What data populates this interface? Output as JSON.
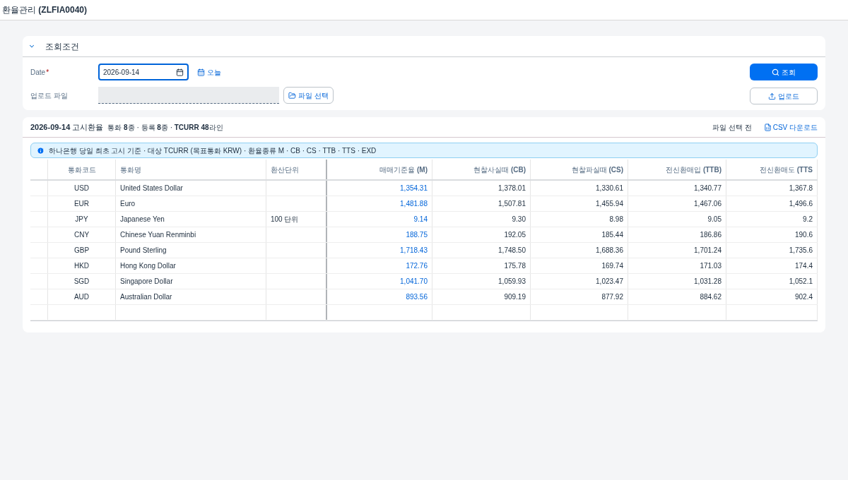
{
  "page_title": "환율관리 **(ZLFIA0040)**",
  "filter_panel": {
    "title": "조회조건",
    "expanded": true,
    "date_label": "Date",
    "required_mark": "*",
    "date_value": "2026-09-14",
    "today_link": "오늘",
    "upload_label": "업로드 파일",
    "file_button": "파일 선택",
    "search_button": "조회",
    "upload_button": "업로드"
  },
  "result_panel": {
    "date": "2026-09-14",
    "title": "고시환율",
    "summary": "통화 **8**종 · 등록 **8**종 · **TCURR 48**라인",
    "file_status": "파일 선택 전",
    "csv_link": "CSV 다운로드",
    "info": "하나은행 당일 최초 고시 기준 · 대상 TCURR (목표통화 KRW) · 환율종류 M · CB · CS · TTB · TTS · EXD",
    "table": {
      "columns": [
        "통화코드",
        "통화명",
        "환산단위",
        "매매기준율 **(M)**",
        "현찰사실때 **(CB)**",
        "현찰파실때 **(CS)**",
        "전신환매입 **(TTB)**",
        "전신환매도 **(TTS**"
      ],
      "rows": [
        [
          "USD",
          "United States Dollar",
          "",
          "1,354.31",
          "1,378.01",
          "1,330.61",
          "1,340.77",
          "1,367.8"
        ],
        [
          "EUR",
          "Euro",
          "",
          "1,481.88",
          "1,507.81",
          "1,455.94",
          "1,467.06",
          "1,496.6"
        ],
        [
          "JPY",
          "Japanese Yen",
          "100 단위",
          "9.14",
          "9.30",
          "8.98",
          "9.05",
          "9.2"
        ],
        [
          "CNY",
          "Chinese Yuan Renminbi",
          "",
          "188.75",
          "192.05",
          "185.44",
          "186.86",
          "190.6"
        ],
        [
          "GBP",
          "Pound Sterling",
          "",
          "1,718.43",
          "1,748.50",
          "1,688.36",
          "1,701.24",
          "1,735.6"
        ],
        [
          "HKD",
          "Hong Kong Dollar",
          "",
          "172.76",
          "175.78",
          "169.74",
          "171.03",
          "174.4"
        ],
        [
          "SGD",
          "Singapore Dollar",
          "",
          "1,041.70",
          "1,059.93",
          "1,023.47",
          "1,031.28",
          "1,052.1"
        ],
        [
          "AUD",
          "Australian Dollar",
          "",
          "893.56",
          "909.19",
          "877.92",
          "884.62",
          "902.4"
        ]
      ]
    }
  }
}
